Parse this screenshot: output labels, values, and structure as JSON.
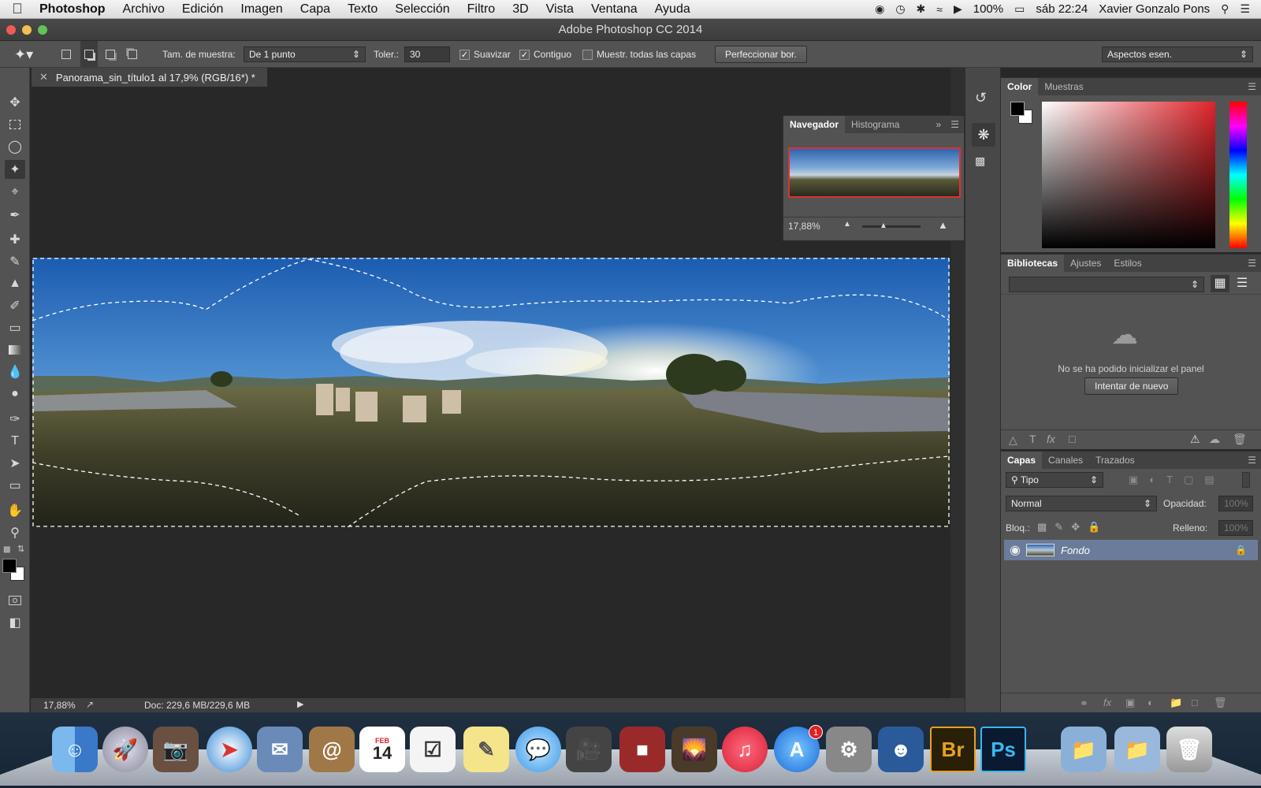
{
  "menubar": {
    "app": "Photoshop",
    "items": [
      "Archivo",
      "Edición",
      "Imagen",
      "Capa",
      "Texto",
      "Selección",
      "Filtro",
      "3D",
      "Vista",
      "Ventana",
      "Ayuda"
    ],
    "battery": "100%",
    "clock": "sáb 22:24",
    "user": "Xavier Gonzalo Pons"
  },
  "window": {
    "title": "Adobe Photoshop CC 2014"
  },
  "options": {
    "sample_label": "Tam. de muestra:",
    "sample_value": "De 1 punto",
    "tolerance_label": "Toler.:",
    "tolerance_value": "30",
    "antialias": "Suavizar",
    "contiguous": "Contiguo",
    "sample_all": "Muestr. todas las capas",
    "refine": "Perfeccionar bor.",
    "workspace": "Aspectos esen."
  },
  "document": {
    "tab_title": "Panorama_sin_título1 al 17,9% (RGB/16*) *",
    "zoom": "17,88%",
    "doc_info": "Doc: 229,6 MB/229,6 MB"
  },
  "navigator": {
    "tabs": [
      "Navegador",
      "Histograma"
    ],
    "zoom": "17,88%"
  },
  "color_panel": {
    "tabs": [
      "Color",
      "Muestras"
    ]
  },
  "libraries_panel": {
    "tabs": [
      "Bibliotecas",
      "Ajustes",
      "Estilos"
    ],
    "message": "No se ha podido inicializar el panel",
    "retry": "Intentar de nuevo"
  },
  "layers_panel": {
    "tabs": [
      "Capas",
      "Canales",
      "Trazados"
    ],
    "filter": "Tipo",
    "blend_mode": "Normal",
    "opacity_label": "Opacidad:",
    "opacity_value": "100%",
    "lock_label": "Bloq.:",
    "fill_label": "Relleno:",
    "fill_value": "100%",
    "layers": [
      {
        "name": "Fondo"
      }
    ]
  },
  "dock": {
    "calendar_month": "FEB",
    "calendar_day": "14",
    "appstore_badge": "1",
    "bridge_label": "Br",
    "photoshop_label": "Ps"
  },
  "colors": {
    "ui_dark": "#535353",
    "canvas_bg": "#282828",
    "selected_layer": "#6a7c99"
  }
}
